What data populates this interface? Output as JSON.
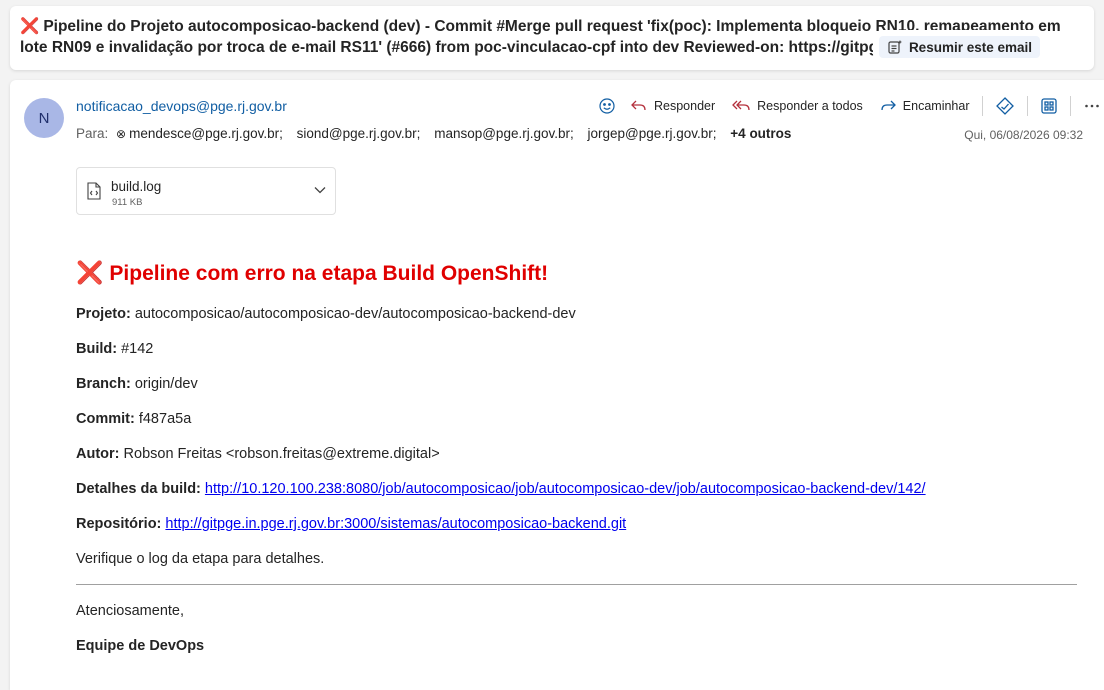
{
  "subject": {
    "mark": "❌",
    "text": "Pipeline do Projeto autocomposicao-backend (dev) - Commit #Merge pull request 'fix(poc): Implementa bloqueio RN10, remapeamento em lote RN09 e invalidação por troca de e-mail RS11' (#666) from poc-vinculacao-cpf into dev  Reviewed-on: https://gitpge....",
    "summarize_label": "Resumir este email"
  },
  "message": {
    "avatar_initial": "N",
    "sender": "notificacao_devops@pge.rj.gov.br",
    "to_label": "Para:",
    "recipients": [
      "mendesce@pge.rj.gov.br;",
      "siond@pge.rj.gov.br;",
      "mansop@pge.rj.gov.br;",
      "jorgep@pge.rj.gov.br;"
    ],
    "more_recipients": "+4 outros",
    "date": "Qui, 06/08/2026 09:32",
    "actions": {
      "reply": "Responder",
      "reply_all": "Responder a todos",
      "forward": "Encaminhar"
    },
    "icons": [
      "emoji-icon",
      "reply-icon",
      "reply-all-icon",
      "forward-icon",
      "tag-icon",
      "apps-icon",
      "more-icon"
    ]
  },
  "attachment": {
    "name": "build.log",
    "size": "911 KB"
  },
  "body": {
    "heading_mark": "❌",
    "heading": "Pipeline com erro na etapa Build OpenShift!",
    "project_label": "Projeto:",
    "project_value": "autocomposicao/autocomposicao-dev/autocomposicao-backend-dev",
    "build_label": "Build:",
    "build_value": "#142",
    "branch_label": "Branch:",
    "branch_value": "origin/dev",
    "commit_label": "Commit:",
    "commit_value": "f487a5a",
    "author_label": "Autor:",
    "author_value": "Robson Freitas <robson.freitas@extreme.digital>",
    "details_label": "Detalhes da build:",
    "details_link": "http://10.120.100.238:8080/job/autocomposicao/job/autocomposicao-dev/job/autocomposicao-backend-dev/142/",
    "repo_label": "Repositório:",
    "repo_link": "http://gitpge.in.pge.rj.gov.br:3000/sistemas/autocomposicao-backend.git",
    "check_log": "Verifique o log da etapa para detalhes.",
    "regards": "Atenciosamente,",
    "team": "Equipe de DevOps"
  },
  "colors": {
    "accent": "#115ea3",
    "error": "#e00000",
    "link": "#0000ee"
  }
}
